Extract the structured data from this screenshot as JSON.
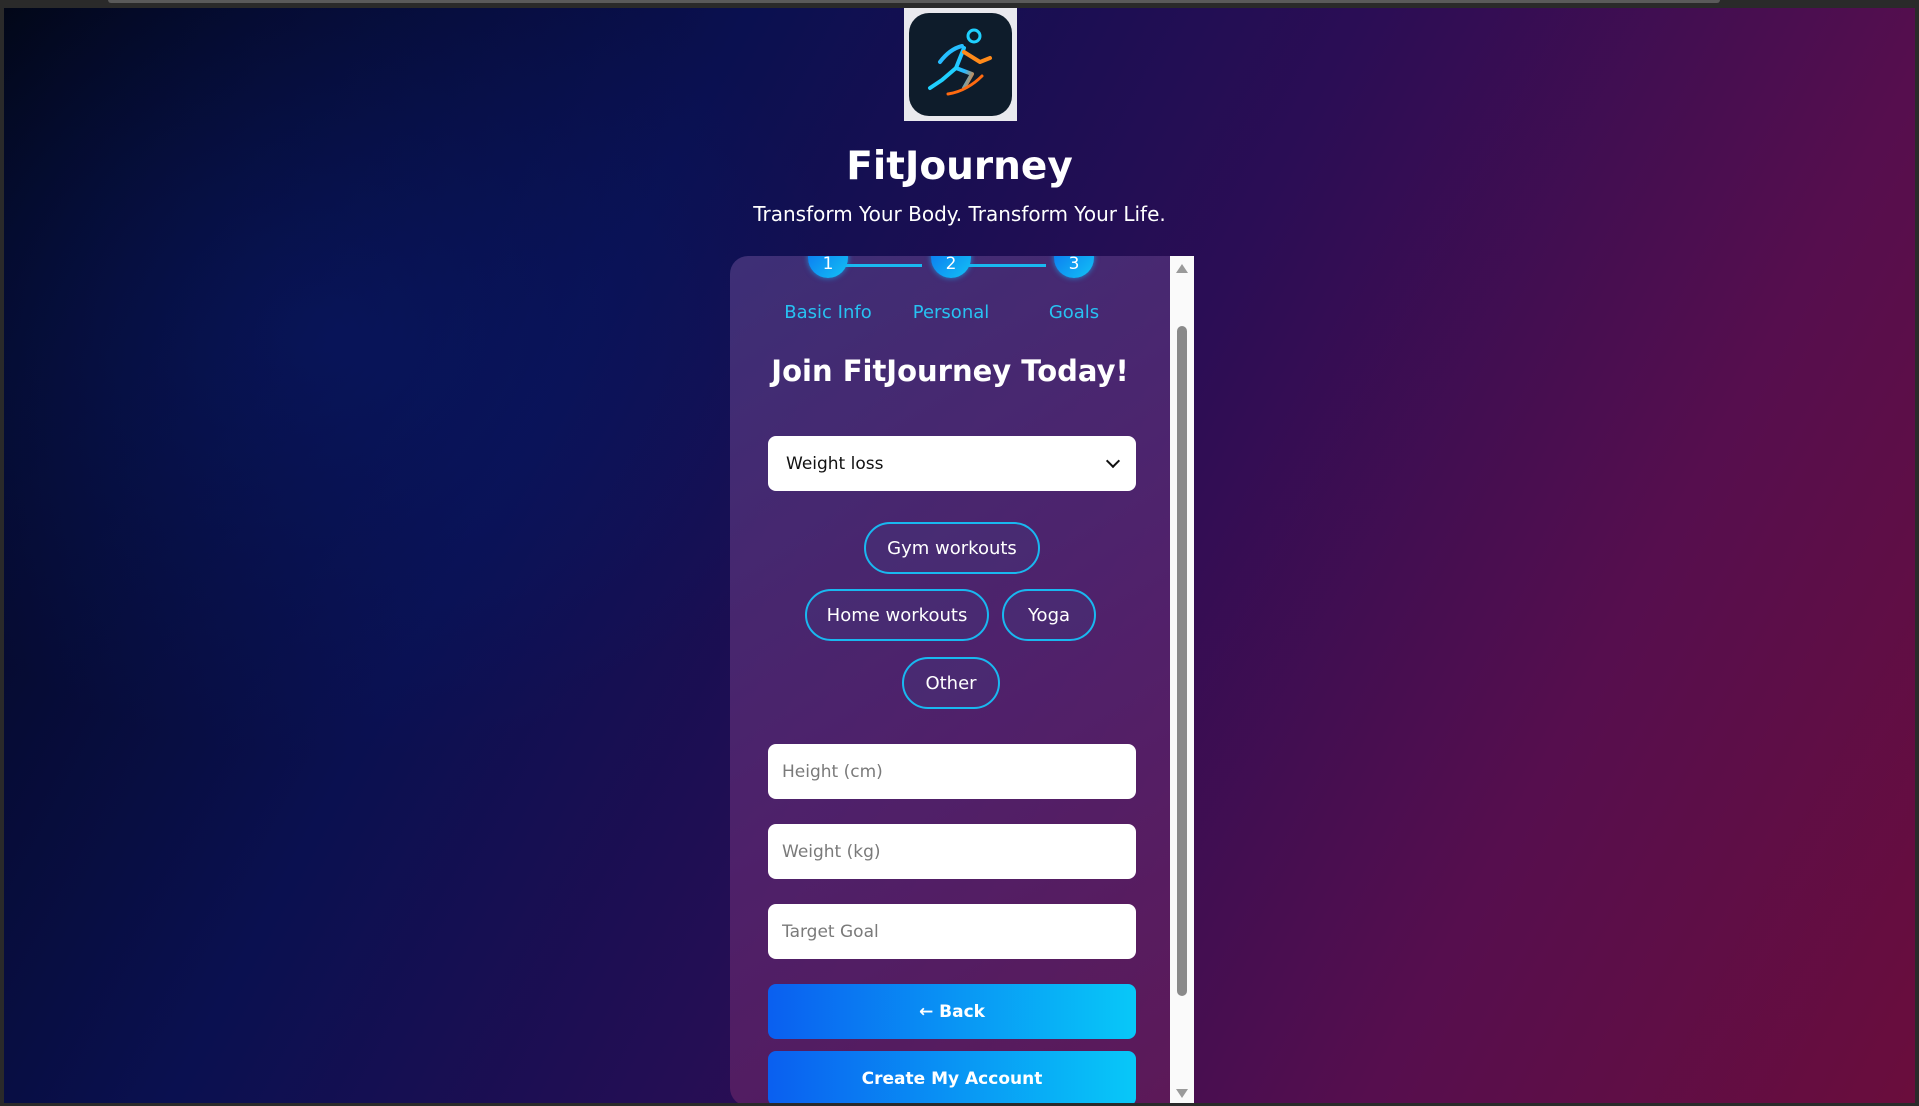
{
  "brand": {
    "title": "FitJourney",
    "tagline": "Transform Your Body. Transform Your Life."
  },
  "steps": [
    {
      "number": "1",
      "label": "Basic Info"
    },
    {
      "number": "2",
      "label": "Personal"
    },
    {
      "number": "3",
      "label": "Goals"
    }
  ],
  "form": {
    "title": "Join FitJourney Today!",
    "goal_select": {
      "selected": "Weight loss"
    },
    "workout_options": [
      "Gym workouts",
      "Home workouts",
      "Yoga",
      "Other"
    ],
    "height_placeholder": "Height (cm)",
    "weight_placeholder": "Weight (kg)",
    "target_placeholder": "Target Goal",
    "back_label": "← Back",
    "submit_label": "Create My Account"
  },
  "colors": {
    "accent": "#19b8f0",
    "button_start": "#0a5ff0",
    "button_end": "#08c8f8",
    "step_label": "#27c2f2"
  },
  "icons": {
    "logo": "running-man-icon",
    "select": "chevron-down-icon"
  }
}
